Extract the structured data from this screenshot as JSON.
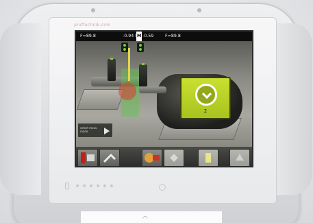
{
  "brand": {
    "watermark": "pruftechnik.com"
  },
  "status_bar": {
    "left_readout": "F=89.8",
    "center_left_readout": "-0.94 S",
    "mode": "M",
    "center_right_readout": "-0.59",
    "right_readout": "F=89.8"
  },
  "alignment": {
    "status_number": "2",
    "status_color": "#b7d12a"
  },
  "measure_panel": {
    "label": "select meas. mode",
    "play_icon": "play-icon"
  },
  "toolbar": {
    "buttons": [
      {
        "name": "dimensions-button",
        "icon": "machine-dimensions-icon"
      },
      {
        "name": "measure-button",
        "icon": "measure-icon"
      },
      {
        "name": "results-button",
        "icon": "results-icon"
      },
      {
        "name": "diagnosis-button",
        "icon": "diagnosis-icon"
      },
      {
        "name": "tolerance-button",
        "icon": "tolerance-icon"
      },
      {
        "name": "move-button",
        "icon": "move-icon"
      }
    ]
  },
  "colors": {
    "accent_green": "#b7d12a",
    "screen_bg": "#141414",
    "laser_red": "#dc3c32",
    "laser_green": "#5ac846"
  }
}
